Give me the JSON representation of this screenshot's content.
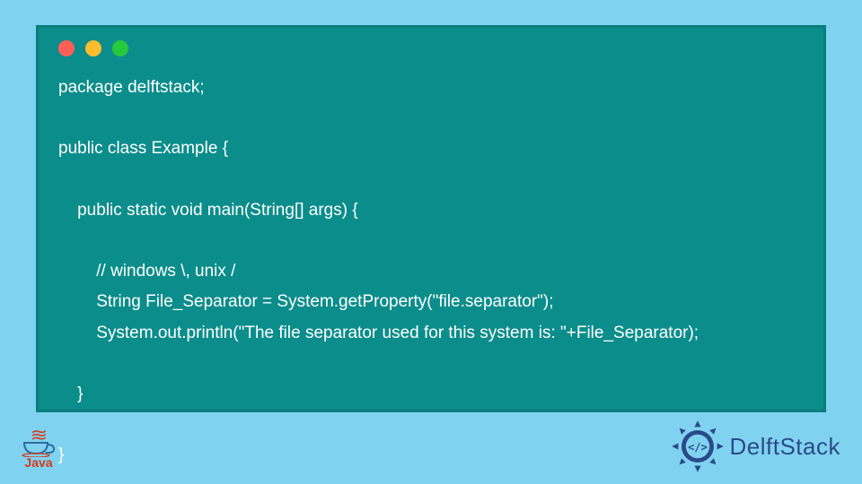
{
  "window": {
    "traffic_lights": {
      "red": "#ff5f56",
      "yellow": "#ffbd2e",
      "green": "#27c93f"
    }
  },
  "code": {
    "lines": [
      "package delftstack;",
      "",
      "public class Example {",
      "",
      "    public static void main(String[] args) {",
      "",
      "        // windows \\, unix /",
      "        String File_Separator = System.getProperty(\"file.separator\");",
      "        System.out.println(\"The file separator used for this system is: \"+File_Separator);",
      "",
      "    }",
      "",
      "}"
    ]
  },
  "footer": {
    "java_label": "Java",
    "delftstack_label": "DelftStack"
  },
  "colors": {
    "page_bg": "#80d3f0",
    "code_bg": "#0b8d8b",
    "code_border": "#0a7d7b",
    "code_text": "#ffffff",
    "java_accent": "#d63a1c",
    "java_blue": "#2f6aa0",
    "delftstack_text": "#2a4a8c",
    "delftstack_emblem": "#2a4a8c"
  }
}
